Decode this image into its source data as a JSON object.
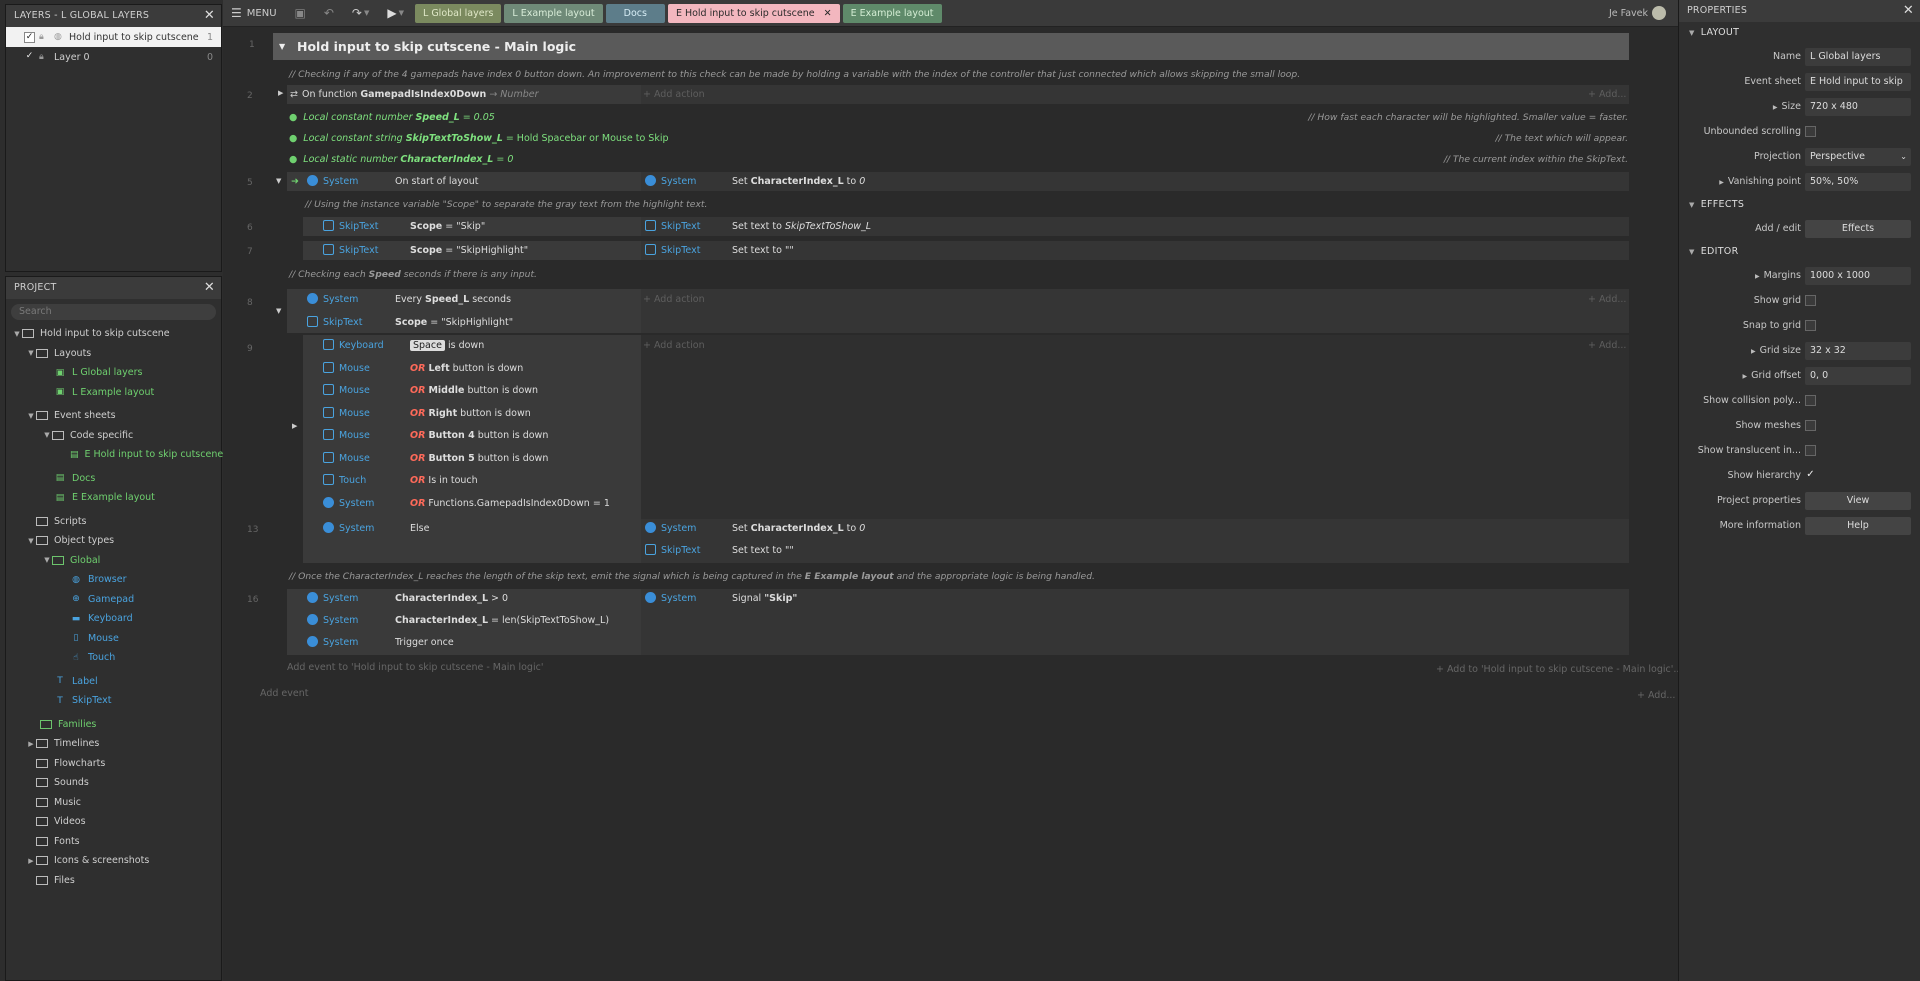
{
  "layers_panel": {
    "title": "LAYERS - L GLOBAL LAYERS",
    "rows": [
      {
        "label": "Hold input to skip cutscene",
        "num": "1"
      },
      {
        "label": "Layer 0",
        "num": "0"
      }
    ]
  },
  "project_panel": {
    "title": "PROJECT",
    "search_placeholder": "Search",
    "tree": [
      {
        "label": "Hold input to skip cutscene"
      },
      {
        "label": "Layouts"
      },
      {
        "label": "L Global layers"
      },
      {
        "label": "L Example layout"
      },
      {
        "label": "Event sheets"
      },
      {
        "label": "Code specific"
      },
      {
        "label": "E Hold input to skip cutscene"
      },
      {
        "label": "Docs"
      },
      {
        "label": "E Example layout"
      },
      {
        "label": "Scripts"
      },
      {
        "label": "Object types"
      },
      {
        "label": "Global"
      },
      {
        "label": "Browser"
      },
      {
        "label": "Gamepad"
      },
      {
        "label": "Keyboard"
      },
      {
        "label": "Mouse"
      },
      {
        "label": "Touch"
      },
      {
        "label": "Label"
      },
      {
        "label": "SkipText"
      },
      {
        "label": "Families"
      },
      {
        "label": "Timelines"
      },
      {
        "label": "Flowcharts"
      },
      {
        "label": "Sounds"
      },
      {
        "label": "Music"
      },
      {
        "label": "Videos"
      },
      {
        "label": "Fonts"
      },
      {
        "label": "Icons & screenshots"
      },
      {
        "label": "Files"
      }
    ]
  },
  "toolbar": {
    "menu_label": "MENU",
    "tabs": [
      {
        "label": "L Global layers"
      },
      {
        "label": "L Example layout"
      },
      {
        "label": "Docs"
      },
      {
        "label": "E Hold input to skip cutscene"
      },
      {
        "label": "E Example layout"
      }
    ],
    "user_name": "Je Favek"
  },
  "sheet": {
    "group_number": "1",
    "group_title": "Hold input to skip cutscene - Main logic",
    "comment1": "//  Checking if any of the 4 gamepads have index 0 button down. An improvement to this check can be made by holding a variable with the index of the controller that just connected which allows skipping the small loop.",
    "ev2_num": "2",
    "fn_prefix": "On function ",
    "fn_name": "GamepadIsIndex0Down",
    "fn_suffix": " → Number",
    "add_action": "+ Add action",
    "add_dots": "+ Add...",
    "lc1_a": "Local constant number ",
    "lc1_b": "Speed_L",
    "lc1_c": " = 0.05",
    "lc1_comment": "//  How fast each character will be highlighted. Smaller value = faster.",
    "lc2_a": "Local constant string ",
    "lc2_b": "SkipTextToShow_L",
    "lc2_c": " = Hold Spacebar or Mouse to Skip",
    "lc2_comment": "//  The text which will appear.",
    "lc3_a": "Local static number ",
    "lc3_b": "CharacterIndex_L",
    "lc3_c": " = 0",
    "lc3_comment": "//  The current index within the SkipText.",
    "ev5_num": "5",
    "system": "System",
    "on_start": "On start of layout",
    "set_ci_a": "Set ",
    "set_ci_b": "CharacterIndex_L",
    "set_ci_c": " to ",
    "set_ci_d": "0",
    "comment2": "//  Using the instance variable \"Scope\" to separate the gray text from the highlight text.",
    "ev6_num": "6",
    "skiptext": "SkipText",
    "scope_skip_a": "Scope",
    "scope_skip_b": " = \"Skip\"",
    "set_text_a": "Set text to ",
    "set_text_b": "SkipTextToShow_L",
    "ev7_num": "7",
    "scope_hl_a": "Scope",
    "scope_hl_b": " = \"SkipHighlight\"",
    "set_text_empty": "Set text to \"\"",
    "comment3_a": "//  Checking each ",
    "comment3_b": "Speed",
    "comment3_c": " seconds if there is any input.",
    "ev8_num": "8",
    "every_a": "Every ",
    "every_b": "Speed_L",
    "every_c": " seconds",
    "ev9_num": "9",
    "keyboard": "Keyboard",
    "space": "Space",
    "is_down": " is down",
    "mouse": "Mouse",
    "or": "OR",
    "left": "Left",
    "middle": "Middle",
    "right": "Right",
    "button4": "Button 4",
    "button5": "Button 5",
    "btn_down": " button is down",
    "touch": "Touch",
    "in_touch": " Is in touch",
    "gamepad_fn": " Functions.GamepadIsIndex0Down = 1",
    "ev13_num": "13",
    "else": "Else",
    "comment4_a": "//  Once the CharacterIndex_L reaches the length of the skip text, emit the signal which is being captured in the ",
    "comment4_b": "E Example layout",
    "comment4_c": " and the appropriate logic is being handled.",
    "ev16_num": "16",
    "ci_gt_a": "CharacterIndex_L",
    "ci_gt_b": " > 0",
    "ci_eq_a": "CharacterIndex_L",
    "ci_eq_b": " = len(SkipTextToShow_L)",
    "trigger_once": "Trigger once",
    "signal_a": "Signal ",
    "signal_b": "\"Skip\"",
    "add_event_to": "Add event to 'Hold input to skip cutscene - Main logic'",
    "add_to": "+ Add to 'Hold input to skip cutscene - Main logic'...",
    "add_event": "Add event",
    "add_dots2": "+ Add..."
  },
  "properties": {
    "title": "PROPERTIES",
    "sections": {
      "layout": "LAYOUT",
      "effects": "EFFECTS",
      "editor": "EDITOR"
    },
    "name_label": "Name",
    "name_val": "L Global layers",
    "event_sheet_label": "Event sheet",
    "event_sheet_val": "E Hold input to skip",
    "size_label": "Size",
    "size_val": "720 x 480",
    "unbounded_label": "Unbounded scrolling",
    "projection_label": "Projection",
    "projection_val": "Perspective",
    "vanishing_label": "Vanishing point",
    "vanishing_val": "50%, 50%",
    "add_edit_label": "Add / edit",
    "effects_btn": "Effects",
    "margins_label": "Margins",
    "margins_val": "1000 x 1000",
    "show_grid_label": "Show grid",
    "snap_label": "Snap to grid",
    "grid_size_label": "Grid size",
    "grid_size_val": "32 x 32",
    "grid_offset_label": "Grid offset",
    "grid_offset_val": "0, 0",
    "collision_label": "Show collision poly...",
    "meshes_label": "Show meshes",
    "translucent_label": "Show translucent in...",
    "hierarchy_label": "Show hierarchy",
    "project_props_label": "Project properties",
    "view_btn": "View",
    "more_info_label": "More information",
    "help_btn": "Help"
  }
}
